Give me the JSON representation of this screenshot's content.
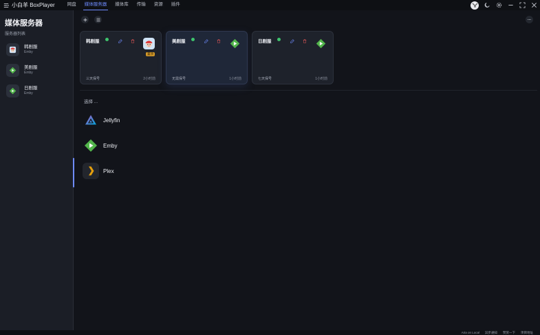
{
  "app": {
    "title": "小白羊 BoxPlayer"
  },
  "nav": [
    {
      "label": "网盘",
      "active": false
    },
    {
      "label": "媒体服务器",
      "active": true
    },
    {
      "label": "媒体库",
      "active": false
    },
    {
      "label": "传输",
      "active": false
    },
    {
      "label": "资源",
      "active": false
    },
    {
      "label": "插件",
      "active": false
    }
  ],
  "sidebar": {
    "title": "媒体服务器",
    "subtitle": "服务器列表",
    "items": [
      {
        "name": "韩剧服",
        "type": "Emby",
        "icon": "anime-avatar-icon"
      },
      {
        "name": "美剧服",
        "type": "Emby",
        "icon": "emby-logo-icon"
      },
      {
        "name": "日剧服",
        "type": "Emby",
        "icon": "emby-logo-icon"
      }
    ]
  },
  "cards": [
    {
      "name": "韩剧服",
      "line": "三天保号",
      "time": "2小时前",
      "badge": "置顶",
      "logo": "anime-avatar-icon"
    },
    {
      "name": "美剧服",
      "line": "无需保号",
      "time": "1小时前",
      "logo": "emby-logo-icon"
    },
    {
      "name": "日剧服",
      "line": "七天保号",
      "time": "1小时前",
      "logo": "emby-logo-icon"
    }
  ],
  "select": {
    "label": "选择 ...",
    "options": [
      {
        "label": "Jellyfin",
        "icon": "jellyfin-logo-icon"
      },
      {
        "label": "Emby",
        "icon": "emby-logo-icon"
      },
      {
        "label": "Plex",
        "icon": "plex-logo-icon"
      }
    ]
  },
  "statusbar": {
    "items": [
      "Aria on Local",
      "异步通知",
      "赞赏一下",
      "项目地址"
    ]
  },
  "colors": {
    "accent": "#6f8cff",
    "online": "#3ec46d",
    "delete": "#e05555",
    "emby_green": "#52b54b",
    "plex_orange": "#e5a00d"
  }
}
